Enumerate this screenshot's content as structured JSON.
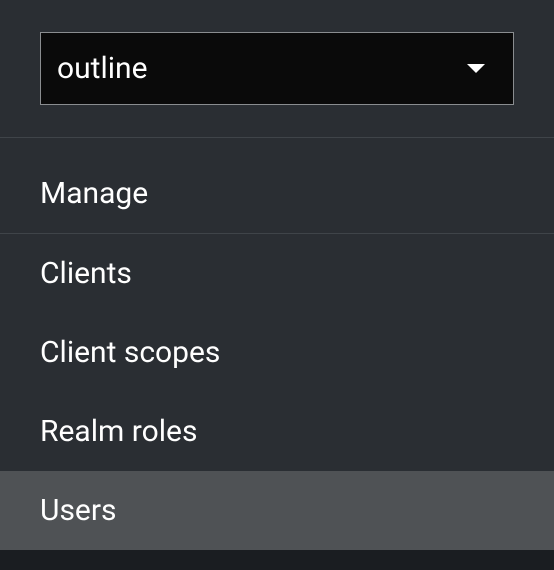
{
  "realm_selector": {
    "selected": "outline"
  },
  "nav": {
    "section_label": "Manage",
    "items": [
      {
        "label": "Clients",
        "active": false
      },
      {
        "label": "Client scopes",
        "active": false
      },
      {
        "label": "Realm roles",
        "active": false
      },
      {
        "label": "Users",
        "active": true
      }
    ]
  }
}
